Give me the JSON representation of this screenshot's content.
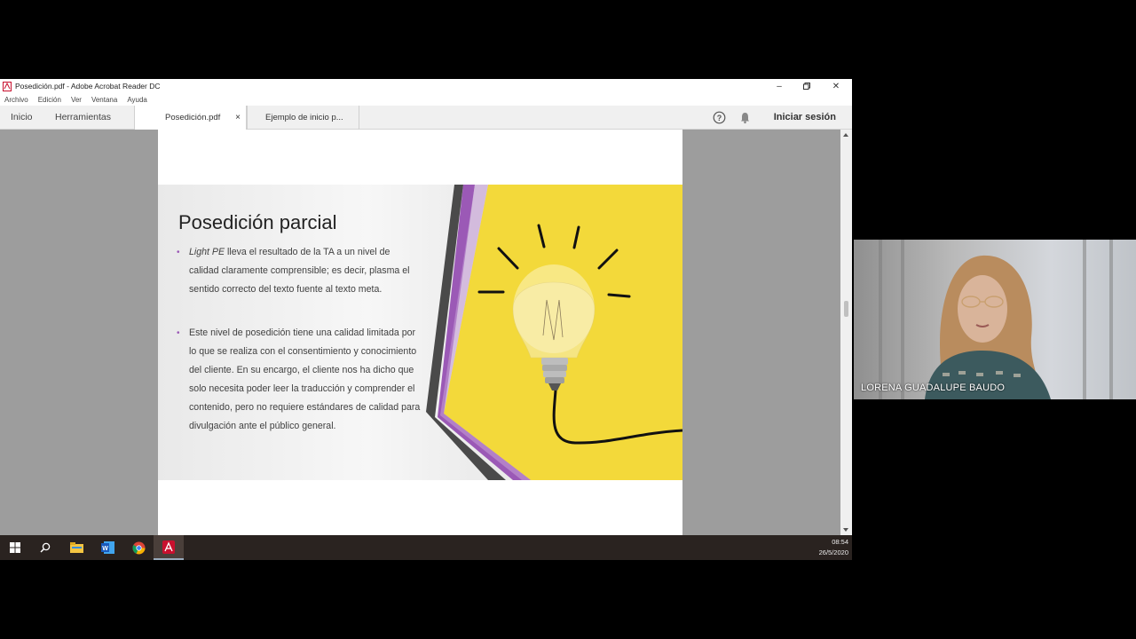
{
  "window": {
    "title": "Posedición.pdf - Adobe Acrobat Reader DC",
    "controls": [
      "minimize-icon",
      "restore-icon",
      "close-icon"
    ]
  },
  "menu": {
    "items": [
      "Archivo",
      "Edición",
      "Ver",
      "Ventana",
      "Ayuda"
    ]
  },
  "tabs": {
    "home": "Inicio",
    "tools": "Herramientas",
    "doc1": "Posedición.pdf",
    "doc2": "Ejemplo de inicio p...",
    "close_glyph": "×",
    "sign_in": "Iniciar sesión"
  },
  "slide": {
    "title": "Posedición parcial",
    "bullet1_em": "Light PE",
    "bullet1_rest": " lleva el resultado de la TA a un nivel de calidad claramente comprensible; es decir, plasma el sentido correcto del texto fuente al texto meta.",
    "bullet2": "Este nivel de posedición tiene una calidad limitada por lo que se realiza con el consentimiento y conocimiento del cliente. En su encargo, el cliente nos ha dicho que solo necesita poder leer la traducción y comprender el contenido, pero no requiere estándares de calidad para divulgación ante el público general.",
    "colors": {
      "yellow": "#f3d93a",
      "purple": "#9b59b6",
      "dark": "#4a4a4a"
    }
  },
  "taskbar": {
    "icons": [
      "windows-start-icon",
      "search-icon",
      "file-explorer-icon",
      "word-icon",
      "chrome-icon",
      "acrobat-icon"
    ],
    "time": "08:54",
    "date": "26/5/2020"
  },
  "webcam": {
    "name": "LORENA GUADALUPE BAUDO"
  }
}
